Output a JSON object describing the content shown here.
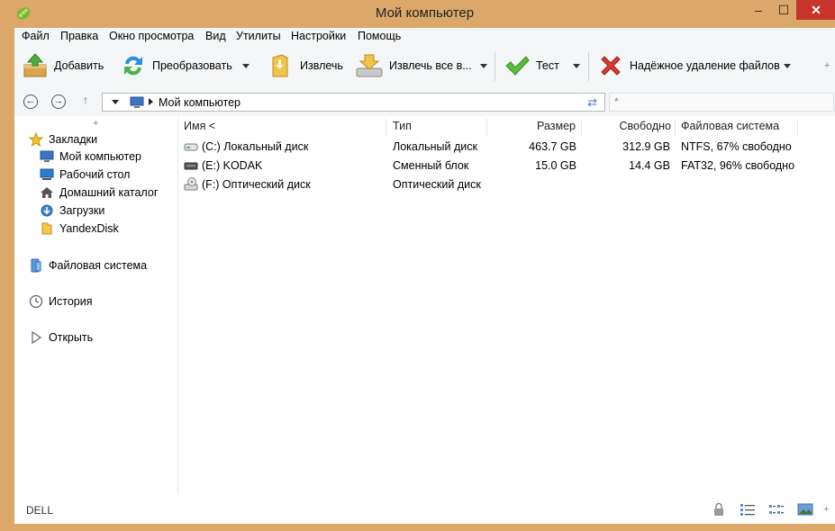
{
  "window": {
    "title": "Мой компьютер",
    "min_label": "–",
    "max_label": "☐",
    "close_label": "✕",
    "frame_color": "#dca86a",
    "close_color": "#c7342b"
  },
  "menu": [
    "Файл",
    "Правка",
    "Окно просмотра",
    "Вид",
    "Утилиты",
    "Настройки",
    "Помощь"
  ],
  "toolbar": {
    "add": "Добавить",
    "convert": "Преобразовать",
    "extract": "Извлечь",
    "extract_all": "Извлечь все в...",
    "test": "Тест",
    "secure_delete": "Надёжное удаление файлов",
    "more": "+"
  },
  "nav": {
    "back": "←",
    "forward": "→",
    "up": "↑",
    "address": "Мой компьютер",
    "search_placeholder": "*"
  },
  "sidebar": {
    "collapse": "+",
    "bookmarks": "Закладки",
    "bookmark_items": [
      "Мой компьютер",
      "Рабочий стол",
      "Домашний каталог",
      "Загрузки",
      "YandexDisk"
    ],
    "filesystem": "Файловая система",
    "history": "История",
    "open": "Открыть"
  },
  "columns": [
    "Имя <",
    "Тип",
    "Размер",
    "Свободно",
    "Файловая система"
  ],
  "rows": [
    {
      "icon": "hard-drive-icon",
      "name": "(C:) Локальный диск",
      "type": "Локальный диск",
      "size": "463.7 GB",
      "free": "312.9 GB",
      "fs": "NTFS, 67% свободно"
    },
    {
      "icon": "removable-drive-icon",
      "name": "(E:) KODAK",
      "type": "Сменный блок",
      "size": "15.0 GB",
      "free": "14.4 GB",
      "fs": "FAT32, 96% свободно"
    },
    {
      "icon": "optical-drive-icon",
      "name": "(F:) Оптический диск",
      "type": "Оптический диск",
      "size": "",
      "free": "",
      "fs": ""
    }
  ],
  "status": {
    "text": "DELL",
    "more": "+"
  }
}
